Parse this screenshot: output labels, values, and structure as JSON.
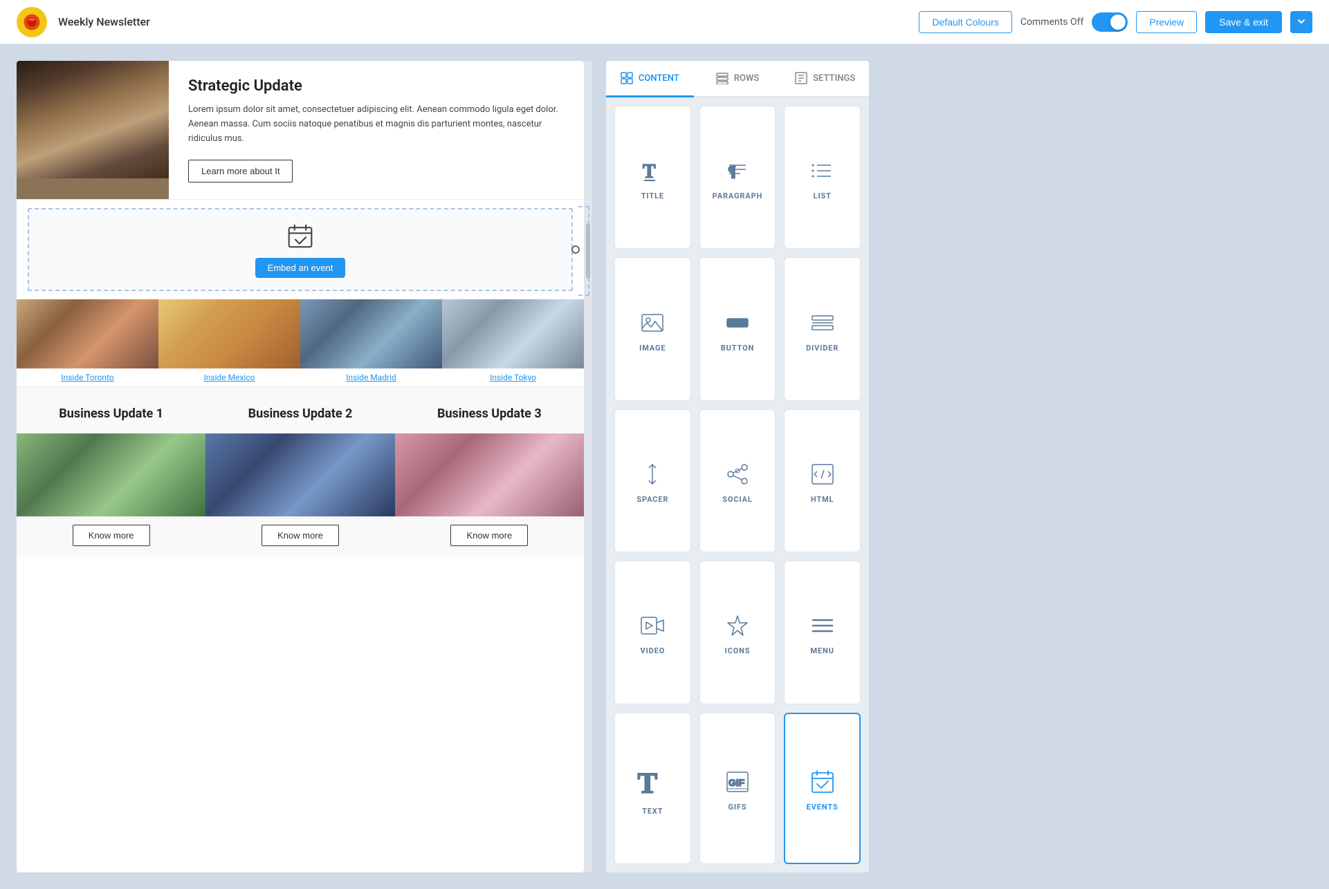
{
  "app": {
    "logo_alt": "App Logo",
    "title": "Weekly Newsletter"
  },
  "topbar": {
    "default_colours_btn": "Default Colours",
    "comments_label": "Comments Off",
    "preview_btn": "Preview",
    "save_exit_btn": "Save & exit"
  },
  "canvas": {
    "strategic": {
      "title": "Strategic Update",
      "body": "Lorem ipsum dolor sit amet, consectetuer adipiscing elit. Aenean commodo ligula eget dolor. Aenean massa. Cum sociis natoque penatibus et magnis dis parturient montes, nascetur ridiculus mus.",
      "cta": "Learn more about It"
    },
    "embed": {
      "btn_label": "Embed an event"
    },
    "locations": [
      {
        "label": "Inside Toronto"
      },
      {
        "label": "Inside Mexico"
      },
      {
        "label": "Inside Madrid"
      },
      {
        "label": "Inside Tokyo"
      }
    ],
    "business_updates": [
      {
        "title": "Business Update 1",
        "know_more": "Know more"
      },
      {
        "title": "Business Update 2",
        "know_more": "Know more"
      },
      {
        "title": "Business Update 3",
        "know_more": "Know more"
      }
    ]
  },
  "panel": {
    "tabs": [
      {
        "id": "content",
        "label": "CONTENT",
        "active": true
      },
      {
        "id": "rows",
        "label": "ROWS",
        "active": false
      },
      {
        "id": "settings",
        "label": "SETTINGS",
        "active": false
      }
    ],
    "content_items": [
      {
        "id": "title",
        "label": "TITLE"
      },
      {
        "id": "paragraph",
        "label": "PARAGRAPH"
      },
      {
        "id": "list",
        "label": "LIST"
      },
      {
        "id": "image",
        "label": "IMAGE"
      },
      {
        "id": "button",
        "label": "BUTTON"
      },
      {
        "id": "divider",
        "label": "DIVIDER"
      },
      {
        "id": "spacer",
        "label": "SPACER"
      },
      {
        "id": "social",
        "label": "SOCIAL"
      },
      {
        "id": "html",
        "label": "HTML"
      },
      {
        "id": "video",
        "label": "VIDEO"
      },
      {
        "id": "icons",
        "label": "ICONS"
      },
      {
        "id": "menu",
        "label": "MENU"
      },
      {
        "id": "text",
        "label": "TEXT"
      },
      {
        "id": "gifs",
        "label": "GIFS"
      },
      {
        "id": "events",
        "label": "EVENTS",
        "active": true
      }
    ]
  },
  "colors": {
    "accent": "#2196f3",
    "border": "#dde3ea",
    "text_muted": "#5a7a9a"
  }
}
